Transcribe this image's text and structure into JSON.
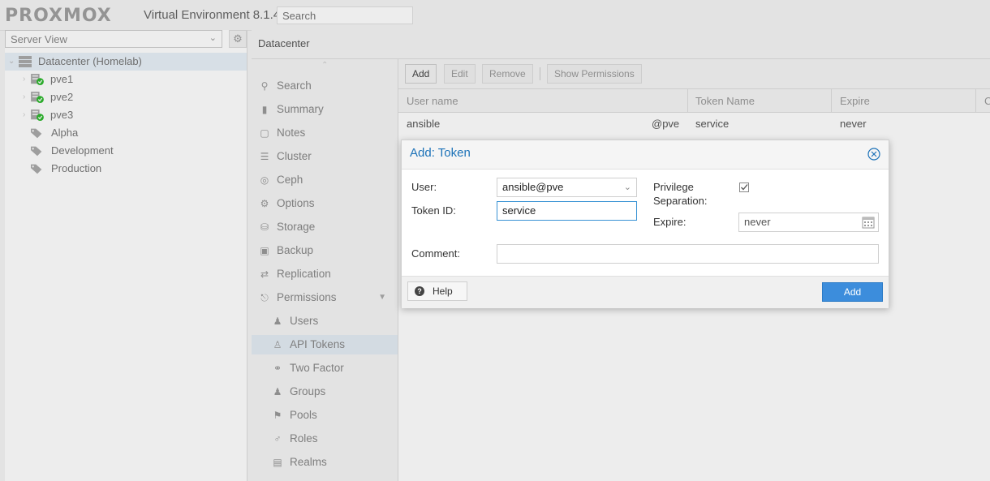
{
  "header": {
    "logo_text": "PROXMOX",
    "version": "Virtual Environment 8.1.4",
    "search_placeholder": "Search"
  },
  "tree": {
    "view": "Server View",
    "items": [
      {
        "label": "Datacenter (Homelab)",
        "type": "datacenter"
      },
      {
        "label": "pve1",
        "type": "node"
      },
      {
        "label": "pve2",
        "type": "node"
      },
      {
        "label": "pve3",
        "type": "node"
      },
      {
        "label": "Alpha",
        "type": "tag"
      },
      {
        "label": "Development",
        "type": "tag"
      },
      {
        "label": "Production",
        "type": "tag"
      }
    ]
  },
  "panel": {
    "title": "Datacenter"
  },
  "menu": {
    "items": [
      {
        "label": "Search",
        "icon": "search-icon"
      },
      {
        "label": "Summary",
        "icon": "book-icon"
      },
      {
        "label": "Notes",
        "icon": "note-icon"
      },
      {
        "label": "Cluster",
        "icon": "server-icon"
      },
      {
        "label": "Ceph",
        "icon": "ceph-icon"
      },
      {
        "label": "Options",
        "icon": "gear-icon"
      },
      {
        "label": "Storage",
        "icon": "database-icon"
      },
      {
        "label": "Backup",
        "icon": "floppy-icon"
      },
      {
        "label": "Replication",
        "icon": "retweet-icon"
      },
      {
        "label": "Permissions",
        "icon": "unlock-icon"
      },
      {
        "label": "Users",
        "icon": "user-icon"
      },
      {
        "label": "API Tokens",
        "icon": "user-outline-icon"
      },
      {
        "label": "Two Factor",
        "icon": "key-icon"
      },
      {
        "label": "Groups",
        "icon": "users-icon"
      },
      {
        "label": "Pools",
        "icon": "tags-icon"
      },
      {
        "label": "Roles",
        "icon": "male-icon"
      },
      {
        "label": "Realms",
        "icon": "address-book-icon"
      }
    ]
  },
  "toolbar": {
    "add": "Add",
    "edit": "Edit",
    "remove": "Remove",
    "show_permissions": "Show Permissions"
  },
  "grid": {
    "columns": [
      "User name",
      "Token Name",
      "Expire",
      "C"
    ],
    "rows": [
      {
        "user": "ansible",
        "realm": "@pve",
        "token": "service",
        "expire": "never"
      }
    ]
  },
  "dialog": {
    "title": "Add: Token",
    "user_label": "User:",
    "user_value": "ansible@pve",
    "token_label": "Token ID:",
    "token_value": "service",
    "privsep_label_1": "Privilege",
    "privsep_label_2": "Separation:",
    "privsep_checked": true,
    "expire_label": "Expire:",
    "expire_value": "never",
    "comment_label": "Comment:",
    "comment_value": "",
    "help_button": "Help",
    "add_button": "Add"
  },
  "colors": {
    "accent": "#3c8ddc",
    "title_blue": "#1c72b8",
    "status_green": "#2eb82e"
  }
}
